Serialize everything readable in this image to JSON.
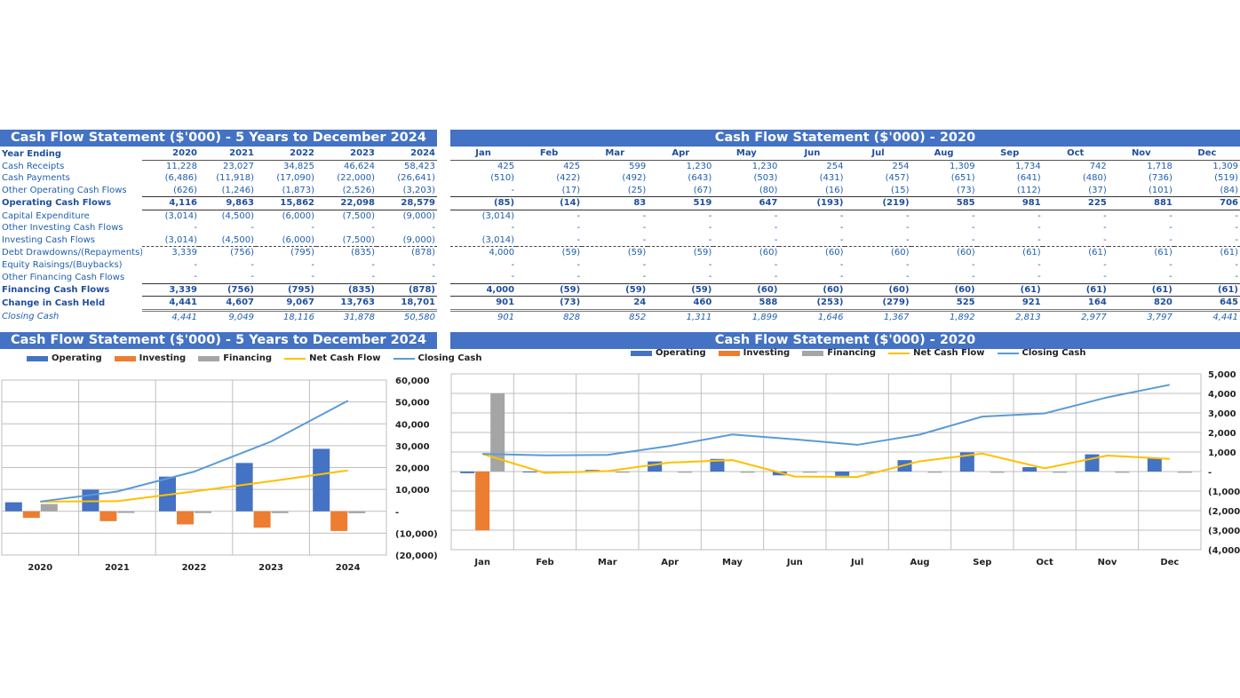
{
  "annual": {
    "title": "Cash Flow Statement ($'000) - 5 Years to December 2024",
    "header_label": "Year Ending",
    "columns": [
      "2020",
      "2021",
      "2022",
      "2023",
      "2024"
    ],
    "rows": [
      {
        "label": "Cash Receipts",
        "style": "normal",
        "values": [
          "11,228",
          "23,027",
          "34,825",
          "46,624",
          "58,423"
        ]
      },
      {
        "label": "Cash Payments",
        "style": "normal",
        "values": [
          "(6,486)",
          "(11,918)",
          "(17,090)",
          "(22,000)",
          "(26,641)"
        ]
      },
      {
        "label": "Other Operating Cash Flows",
        "style": "normal",
        "values": [
          "(626)",
          "(1,246)",
          "(1,873)",
          "(2,526)",
          "(3,203)"
        ]
      },
      {
        "label": "Operating Cash Flows",
        "style": "sub",
        "values": [
          "4,116",
          "9,863",
          "15,862",
          "22,098",
          "28,579"
        ]
      },
      {
        "label": "Capital Expenditure",
        "style": "normal",
        "values": [
          "(3,014)",
          "(4,500)",
          "(6,000)",
          "(7,500)",
          "(9,000)"
        ]
      },
      {
        "label": "Other Investing Cash Flows",
        "style": "normal",
        "values": [
          "-",
          "-",
          "-",
          "-",
          "-"
        ]
      },
      {
        "label": "Investing Cash Flows",
        "style": "inv",
        "values": [
          "(3,014)",
          "(4,500)",
          "(6,000)",
          "(7,500)",
          "(9,000)"
        ]
      },
      {
        "label": "Debt Drawdowns/(Repayments)",
        "style": "normal",
        "values": [
          "3,339",
          "(756)",
          "(795)",
          "(835)",
          "(878)"
        ]
      },
      {
        "label": "Equity Raisings/(Buybacks)",
        "style": "normal",
        "values": [
          "-",
          "-",
          "-",
          "-",
          "-"
        ]
      },
      {
        "label": "Other Financing Cash Flows",
        "style": "normal",
        "values": [
          "-",
          "-",
          "-",
          "-",
          "-"
        ]
      },
      {
        "label": "Financing Cash Flows",
        "style": "sub",
        "values": [
          "3,339",
          "(756)",
          "(795)",
          "(835)",
          "(878)"
        ]
      },
      {
        "label": "Change in Cash Held",
        "style": "dbl",
        "values": [
          "4,441",
          "4,607",
          "9,067",
          "13,763",
          "18,701"
        ]
      },
      {
        "label": "Closing Cash",
        "style": "close",
        "values": [
          "4,441",
          "9,049",
          "18,116",
          "31,878",
          "50,580"
        ]
      }
    ]
  },
  "monthly": {
    "title": "Cash Flow Statement ($'000) - 2020",
    "columns": [
      "Jan",
      "Feb",
      "Mar",
      "Apr",
      "May",
      "Jun",
      "Jul",
      "Aug",
      "Sep",
      "Oct",
      "Nov",
      "Dec"
    ],
    "rows": [
      {
        "style": "normal",
        "values": [
          "425",
          "425",
          "599",
          "1,230",
          "1,230",
          "254",
          "254",
          "1,309",
          "1,734",
          "742",
          "1,718",
          "1,309"
        ]
      },
      {
        "style": "normal",
        "values": [
          "(510)",
          "(422)",
          "(492)",
          "(643)",
          "(503)",
          "(431)",
          "(457)",
          "(651)",
          "(641)",
          "(480)",
          "(736)",
          "(519)"
        ]
      },
      {
        "style": "normal",
        "values": [
          "-",
          "(17)",
          "(25)",
          "(67)",
          "(80)",
          "(16)",
          "(15)",
          "(73)",
          "(112)",
          "(37)",
          "(101)",
          "(84)"
        ]
      },
      {
        "style": "sub",
        "values": [
          "(85)",
          "(14)",
          "83",
          "519",
          "647",
          "(193)",
          "(219)",
          "585",
          "981",
          "225",
          "881",
          "706"
        ]
      },
      {
        "style": "normal",
        "values": [
          "(3,014)",
          "-",
          "-",
          "-",
          "-",
          "-",
          "-",
          "-",
          "-",
          "-",
          "-",
          "-"
        ]
      },
      {
        "style": "normal",
        "values": [
          "-",
          "-",
          "-",
          "-",
          "-",
          "-",
          "-",
          "-",
          "-",
          "-",
          "-",
          "-"
        ]
      },
      {
        "style": "inv",
        "values": [
          "(3,014)",
          "-",
          "-",
          "-",
          "-",
          "-",
          "-",
          "-",
          "-",
          "-",
          "-",
          "-"
        ]
      },
      {
        "style": "normal",
        "values": [
          "4,000",
          "(59)",
          "(59)",
          "(59)",
          "(60)",
          "(60)",
          "(60)",
          "(60)",
          "(61)",
          "(61)",
          "(61)",
          "(61)"
        ]
      },
      {
        "style": "normal",
        "values": [
          "-",
          "-",
          "-",
          "-",
          "-",
          "-",
          "-",
          "-",
          "-",
          "-",
          "-",
          "-"
        ]
      },
      {
        "style": "normal",
        "values": [
          "-",
          "-",
          "-",
          "-",
          "-",
          "-",
          "-",
          "-",
          "-",
          "-",
          "-",
          "-"
        ]
      },
      {
        "style": "sub",
        "values": [
          "4,000",
          "(59)",
          "(59)",
          "(59)",
          "(60)",
          "(60)",
          "(60)",
          "(60)",
          "(61)",
          "(61)",
          "(61)",
          "(61)"
        ]
      },
      {
        "style": "dbl",
        "values": [
          "901",
          "(73)",
          "24",
          "460",
          "588",
          "(253)",
          "(279)",
          "525",
          "921",
          "164",
          "820",
          "645"
        ]
      },
      {
        "style": "close",
        "values": [
          "901",
          "828",
          "852",
          "1,311",
          "1,899",
          "1,646",
          "1,367",
          "1,892",
          "2,813",
          "2,977",
          "3,797",
          "4,441"
        ]
      }
    ]
  },
  "colors": {
    "banner": "#4472c4",
    "operating": "#4472c4",
    "investing": "#ed7d31",
    "financing": "#a5a5a5",
    "net_cash_flow": "#ffc000",
    "closing_cash": "#5b9bd5",
    "text": "#1f5fae"
  },
  "chart_data": [
    {
      "type": "bar",
      "title": "Cash Flow Statement ($'000) - 5 Years to December 2024",
      "legend": [
        "Operating",
        "Investing",
        "Financing",
        "Net Cash Flow",
        "Closing Cash"
      ],
      "legend_position": "top",
      "categories": [
        "2020",
        "2021",
        "2022",
        "2023",
        "2024"
      ],
      "series": [
        {
          "name": "Operating",
          "kind": "bar",
          "values": [
            4116,
            9863,
            15862,
            22098,
            28579
          ]
        },
        {
          "name": "Investing",
          "kind": "bar",
          "values": [
            -3014,
            -4500,
            -6000,
            -7500,
            -9000
          ]
        },
        {
          "name": "Financing",
          "kind": "bar",
          "values": [
            3339,
            -756,
            -795,
            -835,
            -878
          ]
        },
        {
          "name": "Net Cash Flow",
          "kind": "line",
          "values": [
            4441,
            4607,
            9067,
            13763,
            18701
          ]
        },
        {
          "name": "Closing Cash",
          "kind": "line",
          "values": [
            4441,
            9049,
            18116,
            31878,
            50580
          ]
        }
      ],
      "ylim": [
        -20000,
        60000
      ],
      "yticks": [
        60000,
        50000,
        40000,
        30000,
        20000,
        10000,
        0,
        -10000,
        -20000
      ],
      "ytick_labels": [
        "60,000",
        "50,000",
        "40,000",
        "30,000",
        "20,000",
        "10,000",
        "-",
        "(10,000)",
        "(20,000)"
      ],
      "grid": true,
      "xlabel": "",
      "ylabel": ""
    },
    {
      "type": "bar",
      "title": "Cash Flow Statement ($'000) - 2020",
      "legend": [
        "Operating",
        "Investing",
        "Financing",
        "Net Cash Flow",
        "Closing Cash"
      ],
      "legend_position": "top",
      "categories": [
        "Jan",
        "Feb",
        "Mar",
        "Apr",
        "May",
        "Jun",
        "Jul",
        "Aug",
        "Sep",
        "Oct",
        "Nov",
        "Dec"
      ],
      "series": [
        {
          "name": "Operating",
          "kind": "bar",
          "values": [
            -85,
            -14,
            83,
            519,
            647,
            -193,
            -219,
            585,
            981,
            225,
            881,
            706
          ]
        },
        {
          "name": "Investing",
          "kind": "bar",
          "values": [
            -3014,
            0,
            0,
            0,
            0,
            0,
            0,
            0,
            0,
            0,
            0,
            0
          ]
        },
        {
          "name": "Financing",
          "kind": "bar",
          "values": [
            4000,
            -59,
            -59,
            -59,
            -60,
            -60,
            -60,
            -60,
            -61,
            -61,
            -61,
            -61
          ]
        },
        {
          "name": "Net Cash Flow",
          "kind": "line",
          "values": [
            901,
            -73,
            24,
            460,
            588,
            -253,
            -279,
            525,
            921,
            164,
            820,
            645
          ]
        },
        {
          "name": "Closing Cash",
          "kind": "line",
          "values": [
            901,
            828,
            852,
            1311,
            1899,
            1646,
            1367,
            1892,
            2813,
            2977,
            3797,
            4441
          ]
        }
      ],
      "ylim": [
        -4000,
        5000
      ],
      "yticks": [
        5000,
        4000,
        3000,
        2000,
        1000,
        0,
        -1000,
        -2000,
        -3000,
        -4000
      ],
      "ytick_labels": [
        "5,000",
        "4,000",
        "3,000",
        "2,000",
        "1,000",
        "-",
        "(1,000)",
        "(2,000)",
        "(3,000)",
        "(4,000)"
      ],
      "grid": true,
      "xlabel": "",
      "ylabel": ""
    }
  ]
}
